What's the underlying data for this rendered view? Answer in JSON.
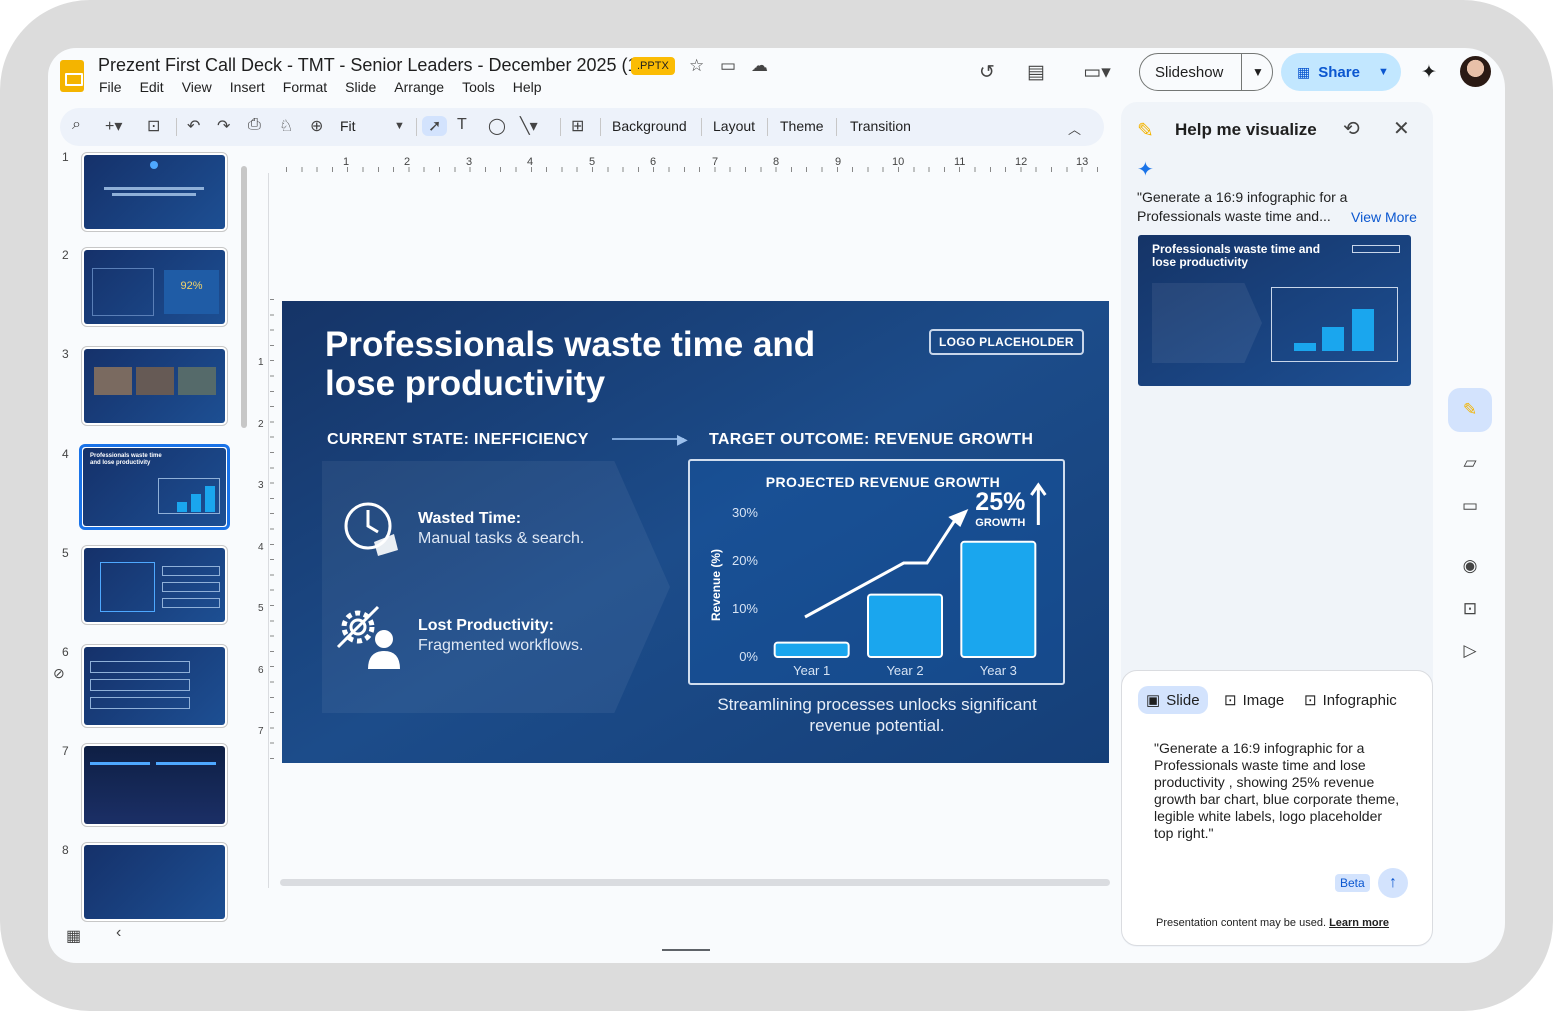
{
  "app": {
    "doc_title": "Prezent First Call Deck - TMT - Senior Leaders - December 2025 (1)",
    "file_badge": ".PPTX"
  },
  "menu": [
    "File",
    "Edit",
    "View",
    "Insert",
    "Format",
    "Slide",
    "Arrange",
    "Tools",
    "Help"
  ],
  "header": {
    "slideshow_label": "Slideshow",
    "share_label": "Share"
  },
  "toolbar": {
    "zoom": "Fit",
    "background": "Background",
    "layout": "Layout",
    "theme": "Theme",
    "transition": "Transition"
  },
  "ruler": {
    "h": [
      "1",
      "2",
      "3",
      "4",
      "5",
      "6",
      "7",
      "8",
      "9",
      "10",
      "11",
      "12",
      "13"
    ],
    "v": [
      "1",
      "2",
      "3",
      "4",
      "5",
      "6",
      "7"
    ]
  },
  "filmstrip": {
    "numbers": [
      "1",
      "2",
      "3",
      "4",
      "5",
      "6",
      "7",
      "8"
    ],
    "selected": "4"
  },
  "slide": {
    "title": "Professionals waste time and lose productivity",
    "logo_placeholder": "LOGO PLACEHOLDER",
    "current_state": "CURRENT STATE: INEFFICIENCY",
    "target_outcome": "TARGET OUTCOME: REVENUE GROWTH",
    "items": [
      {
        "title": "Wasted Time:",
        "desc": "Manual tasks & search."
      },
      {
        "title": "Lost Productivity:",
        "desc": "Fragmented workflows."
      }
    ],
    "caption": "Streamlining processes unlocks significant revenue potential."
  },
  "chart_data": {
    "type": "bar",
    "title": "PROJECTED REVENUE GROWTH",
    "categories": [
      "Year 1",
      "Year 2",
      "Year 3"
    ],
    "values": [
      3,
      13,
      24
    ],
    "ylabel": "Revenue (%)",
    "ylim": [
      0,
      30
    ],
    "yticks": [
      "0%",
      "10%",
      "20%",
      "30%"
    ],
    "annotation_value": "25%",
    "annotation_label": "GROWTH",
    "bar_color": "#1aa6ee"
  },
  "panel": {
    "title": "Help me visualize",
    "quote_preview": "\"Generate a 16:9 infographic for a Professionals waste time and...",
    "view_more": "View More",
    "preview_title": "Professionals waste time and lose productivity",
    "tabs": [
      "Slide",
      "Image",
      "Infographic"
    ],
    "prompt": "\"Generate a 16:9 infographic for a Professionals waste time and lose productivity , showing 25% revenue growth bar chart, blue corporate theme, legible white labels, logo placeholder top right.\"",
    "beta": "Beta",
    "footer_text": "Presentation content may be used.",
    "learn_more": "Learn more"
  },
  "colors": {
    "accent": "#0b57d0",
    "share_bg": "#c2e7ff",
    "slide_bg": "#1c4c8a",
    "pptx_badge": "#fbbc04"
  }
}
